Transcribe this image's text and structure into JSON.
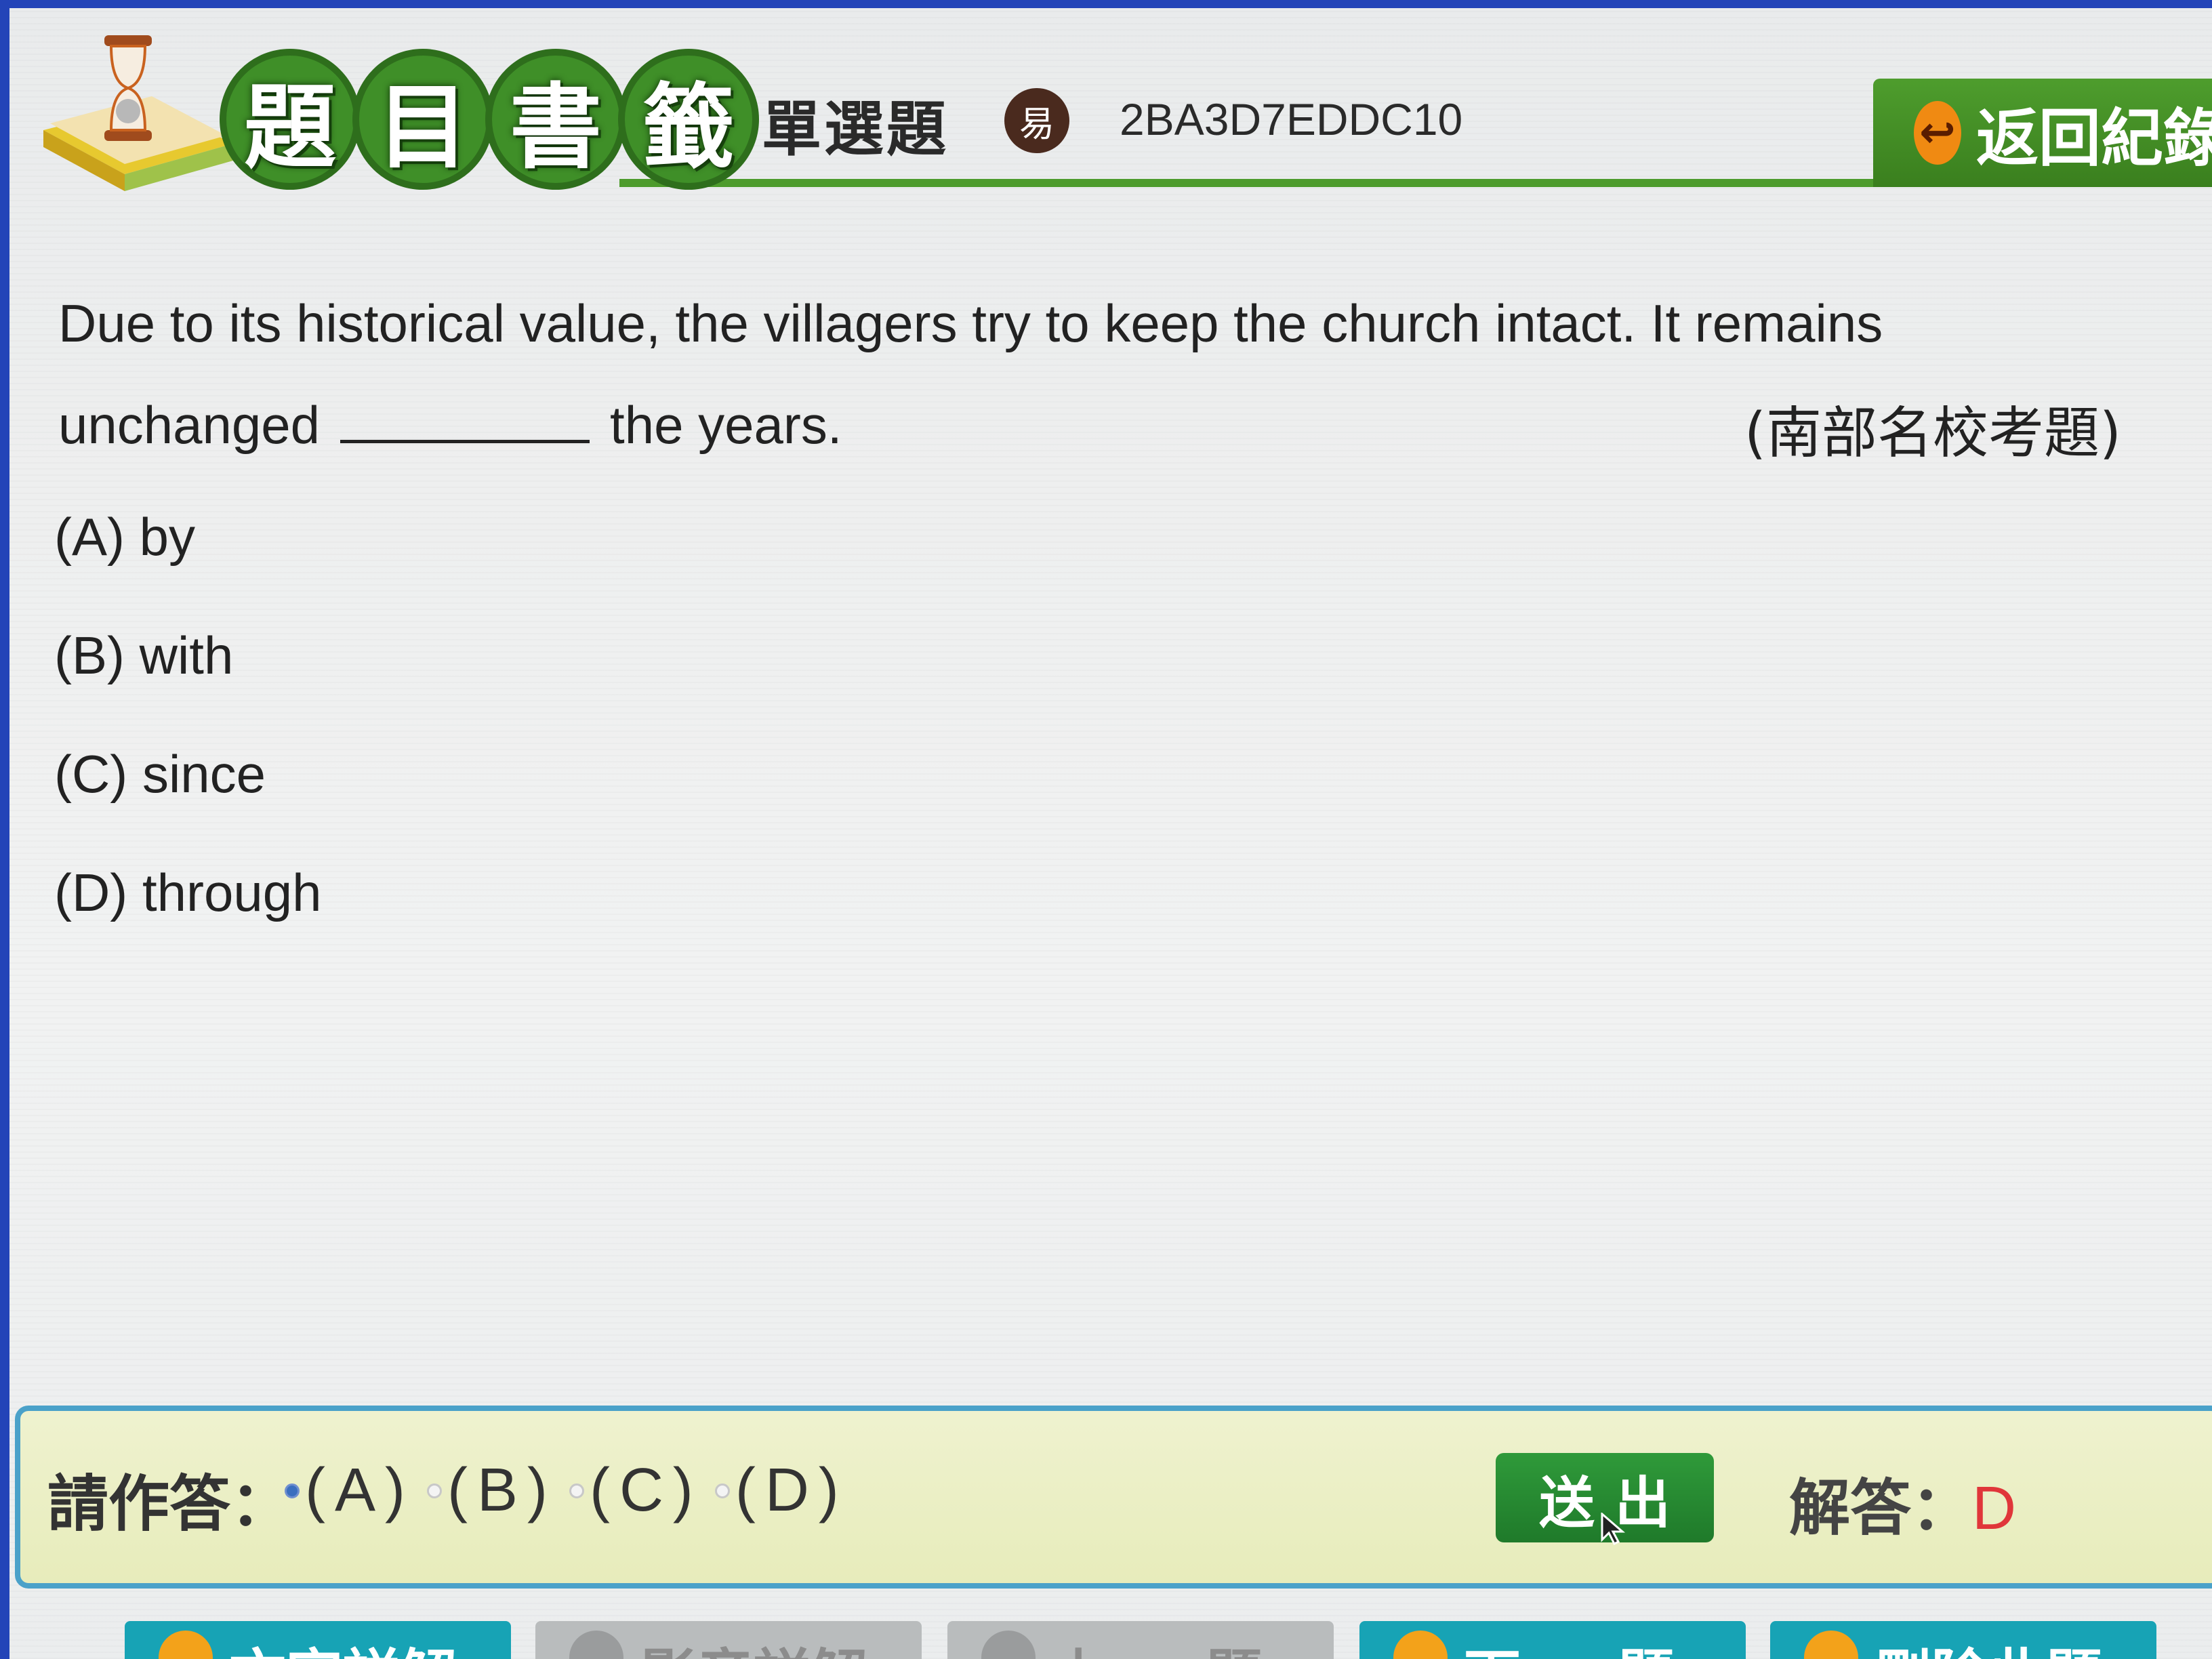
{
  "header": {
    "logo_chars": [
      "題",
      "目",
      "書",
      "籤"
    ],
    "question_type": "單選題",
    "difficulty": "易",
    "question_code": "2BA3D7EDDC10",
    "back_label": "返回紀錄"
  },
  "question": {
    "line1": "Due to its historical value, the villagers try to keep the church intact. It remains",
    "line2_before": "unchanged",
    "line2_after": "the years.",
    "source": "(南部名校考題)"
  },
  "options": [
    {
      "label": "(A) by"
    },
    {
      "label": "(B) with"
    },
    {
      "label": "(C) since"
    },
    {
      "label": "(D) through"
    }
  ],
  "answer_bar": {
    "prompt": "請作答：",
    "choices": [
      {
        "label": "(A)",
        "selected": true
      },
      {
        "label": "(B)",
        "selected": false
      },
      {
        "label": "(C)",
        "selected": false
      },
      {
        "label": "(D)",
        "selected": false
      }
    ],
    "submit_label": "送出",
    "solution_label": "解答：",
    "solution_value": "D"
  },
  "bottom_buttons": [
    {
      "label": "文字詳解",
      "style": "teal"
    },
    {
      "label": "影音詳解",
      "style": "gray"
    },
    {
      "label": "上 一 題",
      "style": "gray"
    },
    {
      "label": "下 一 題",
      "style": "teal"
    },
    {
      "label": "刪除此題",
      "style": "teal"
    }
  ],
  "colors": {
    "accent_green": "#3f8f28",
    "answer_border": "#4aa1c9",
    "solution_red": "#e0363a",
    "button_teal": "#17a3b5"
  }
}
